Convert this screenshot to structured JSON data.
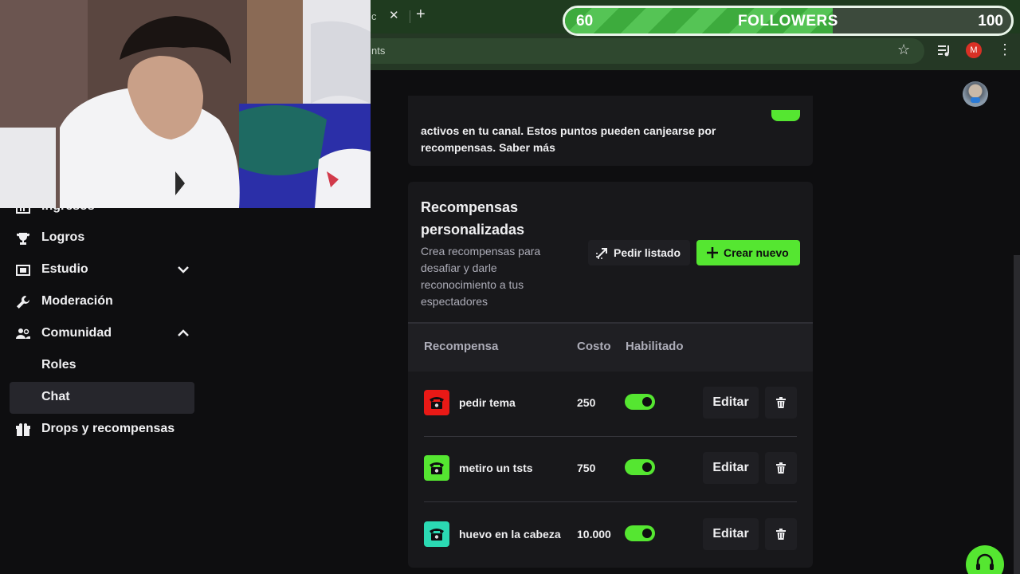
{
  "browser": {
    "tab_fragment": "c",
    "tab_close": "✕",
    "new_tab": "+",
    "url_fragment": "nts",
    "profile_initial": "M",
    "window_minimize": "—",
    "window_close": "✕"
  },
  "goal_overlay": {
    "current": "60",
    "title": "FOLLOWERS",
    "target": "100",
    "progress_fraction": 0.6
  },
  "sidebar": {
    "items": [
      {
        "label": "Ingresos",
        "icon": "chart-icon"
      },
      {
        "label": "Logros",
        "icon": "trophy-icon"
      },
      {
        "label": "Estudio",
        "icon": "studio-icon",
        "chevron": "down"
      },
      {
        "label": "Moderación",
        "icon": "wrench-icon"
      },
      {
        "label": "Comunidad",
        "icon": "community-icon",
        "chevron": "up"
      },
      {
        "label": "Roles",
        "icon": "",
        "sub": true
      },
      {
        "label": "Chat",
        "icon": "",
        "sub": true,
        "active": true
      },
      {
        "label": "Drops y recompensas",
        "icon": "gift-icon"
      }
    ]
  },
  "points_card": {
    "text_line1": "activos en tu canal. Estos puntos pueden canjearse por",
    "text_line2": "recompensas.",
    "link": "Saber más"
  },
  "rewards": {
    "title": "Recompensas personalizadas",
    "description": "Crea recompensas para desafiar y darle reconocimiento a tus espectadores",
    "request_list_button": "Pedir listado",
    "create_new_button": "Crear nuevo",
    "columns": {
      "reward": "Recompensa",
      "cost": "Costo",
      "enabled": "Habilitado"
    },
    "edit_label": "Editar",
    "items": [
      {
        "name": "pedir tema",
        "cost": "250",
        "enabled": true,
        "color": "#e91916"
      },
      {
        "name": "metiro un tsts",
        "cost": "750",
        "enabled": true,
        "color": "#55e631"
      },
      {
        "name": "huevo en la cabeza",
        "cost": "10.000",
        "enabled": true,
        "color": "#2bd9b3"
      }
    ]
  },
  "colors": {
    "accent": "#55e631",
    "background": "#0e0e10",
    "card": "#18181b"
  }
}
